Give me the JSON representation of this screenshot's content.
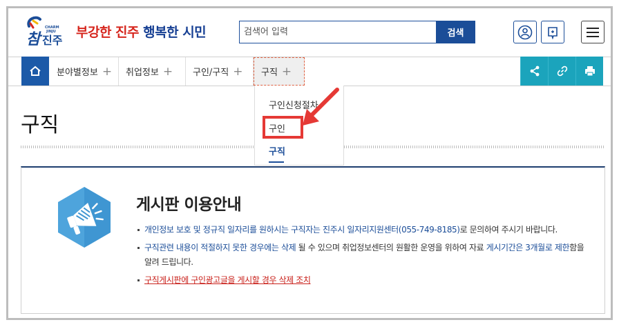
{
  "header": {
    "slogan_part1": "부강한 진주",
    "slogan_part2": "행복한 시민",
    "search": {
      "placeholder": "검색어 입력",
      "value": "",
      "button_label": "검색"
    },
    "login_label": "로그인",
    "menu_label": "전체메뉴"
  },
  "nav": {
    "items": [
      {
        "label": "분야별정보"
      },
      {
        "label": "취업정보"
      },
      {
        "label": "구인/구직"
      },
      {
        "label": "구직",
        "active": true
      }
    ],
    "plus_symbol": "+"
  },
  "dropdown": {
    "items": [
      {
        "label": "구인신청절차"
      },
      {
        "label": "구인"
      },
      {
        "label": "구직",
        "current": true
      }
    ]
  },
  "page_title": "구직",
  "notice": {
    "title": "게시판 이용안내",
    "item1": {
      "a": "개인정보 보호 및 정규직 일자리를 원하시는 구직자는 진주시 일자리지원센터(055-749-8185)",
      "b": "로 문의하여 주시기 바랍니다."
    },
    "item2": {
      "a": "구직관련 내용이 적절하지 못한 경우에는 삭제",
      "b": " 될 수 있으며 취업정보센터의 원활한 운영을 위하여 자료 ",
      "c": "게시기간은 3개월로 제한",
      "d": "함을 알려 드립니다."
    },
    "item3": "구직게시판에 구인광고글을 게시할 경우 삭제 조치"
  },
  "colors": {
    "brand_blue": "#1b4d98",
    "brand_red": "#d6261e",
    "share_teal": "#1ba4bc",
    "highlight_red": "#e53935"
  },
  "icons": {
    "home": "home-icon",
    "share": "share-icon",
    "link": "link-icon",
    "print": "print-icon",
    "user": "user-icon",
    "login": "login-icon",
    "menu": "hamburger-icon",
    "megaphone": "megaphone-icon"
  }
}
